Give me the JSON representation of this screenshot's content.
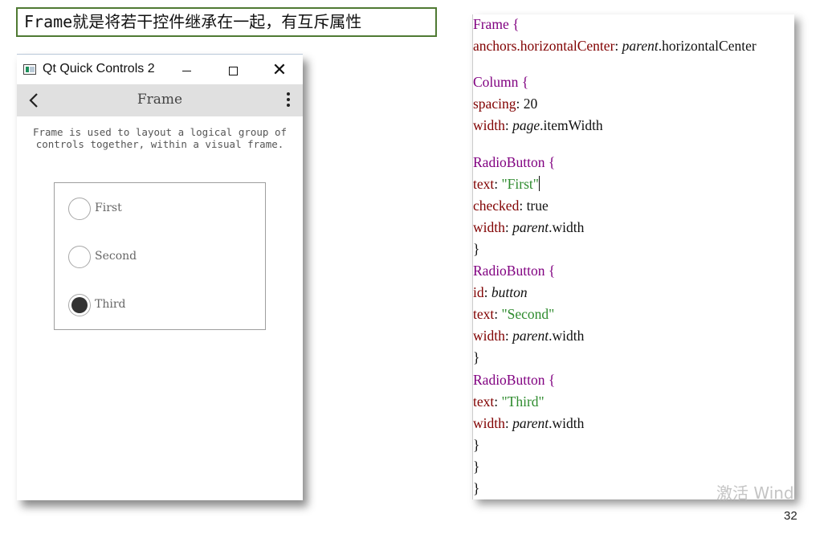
{
  "caption": "Frame就是将若干控件继承在一起，有互斥属性",
  "window": {
    "title": "Qt Quick Controls 2",
    "toolbar_title": "Frame",
    "description": "Frame is used to layout a logical group of controls together, within a visual frame.",
    "radios": [
      {
        "label": "First",
        "checked": false
      },
      {
        "label": "Second",
        "checked": false
      },
      {
        "label": "Third",
        "checked": true
      }
    ]
  },
  "code": {
    "l1_kw": "Frame {",
    "l2_prop": "anchors.horizontalCenter",
    "l2_colon": ": ",
    "l2_it": "parent",
    "l2_rest": ".horizontalCenter",
    "l3_kw": "Column {",
    "l4_prop": "spacing",
    "l4_val": ": 20",
    "l5_prop": "width",
    "l5_colon": ": ",
    "l5_it": "page",
    "l5_rest": ".itemWidth",
    "l6_kw": "RadioButton {",
    "l7_prop": "text",
    "l7_colon": ": ",
    "l7_str": "\"First\"",
    "l8_prop": "checked",
    "l8_val": ": true",
    "l9_prop": "width",
    "l9_colon": ": ",
    "l9_it": "parent",
    "l9_rest": ".width",
    "l10": "}",
    "l11_kw": "RadioButton {",
    "l12_prop": "id",
    "l12_colon": ": ",
    "l12_it": "button",
    "l13_prop": "text",
    "l13_colon": ": ",
    "l13_str": "\"Second\"",
    "l14_prop": "width",
    "l14_colon": ": ",
    "l14_it": "parent",
    "l14_rest": ".width",
    "l15": "}",
    "l16_kw": "RadioButton {",
    "l17_prop": "text",
    "l17_colon": ": ",
    "l17_str": "\"Third\"",
    "l18_prop": "width",
    "l18_colon": ": ",
    "l18_it": "parent",
    "l18_rest": ".width",
    "l19": "}",
    "l20": "}",
    "l21": "}",
    "watermark": "激活 Wind"
  },
  "page_number": "32",
  "colors": {
    "caption_border": "#4f7a33",
    "toolbar_bg": "#e0e0e0",
    "code_keyword": "#800080",
    "code_property": "#800000",
    "code_string": "#2e8b2e"
  }
}
